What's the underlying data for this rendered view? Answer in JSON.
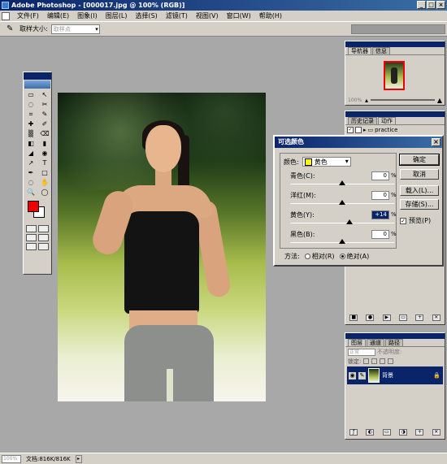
{
  "window": {
    "title": "Adobe Photoshop - [000017.jpg @ 100% (RGB)]",
    "buttons": [
      "_",
      "□",
      "×"
    ]
  },
  "menu": {
    "items": [
      "文件(F)",
      "编辑(E)",
      "图象(I)",
      "图层(L)",
      "选择(S)",
      "滤镜(T)",
      "视图(V)",
      "窗口(W)",
      "帮助(H)"
    ]
  },
  "options": {
    "sample_size_label": "取样大小:",
    "sample_size_value": "取样点"
  },
  "navigator": {
    "tabs": [
      "导航器",
      "信息"
    ],
    "zoom": "100%"
  },
  "history": {
    "tabs": [
      "历史记录",
      "动作"
    ],
    "rows": [
      {
        "check": "✓",
        "label": "practice"
      },
      {
        "check": "✓",
        "label": ""
      },
      {
        "check": "✓",
        "label": ""
      },
      {
        "check": "✓",
        "label": ""
      },
      {
        "check": "✓",
        "label": ""
      },
      {
        "check": "✓",
        "label": ""
      },
      {
        "check": "✓",
        "label": ""
      },
      {
        "check": "✓",
        "label": ""
      }
    ]
  },
  "layers": {
    "tabs": [
      "图层",
      "通道",
      "路径"
    ],
    "blend_mode": "正常",
    "opacity_label": "不透明度:",
    "lock_label": "锁定:",
    "layer_name": "背景"
  },
  "dialog": {
    "title": "可选颜色",
    "color_label": "颜色:",
    "color_value": "黄色",
    "color_swatch": "#ffff00",
    "sliders": [
      {
        "label": "青色(C):",
        "value": "0",
        "unit": "%",
        "position": 0.5,
        "selected": false
      },
      {
        "label": "洋红(M):",
        "value": "0",
        "unit": "%",
        "position": 0.5,
        "selected": false
      },
      {
        "label": "黄色(Y):",
        "value": "+14",
        "unit": "%",
        "position": 0.57,
        "selected": true
      },
      {
        "label": "黑色(B):",
        "value": "0",
        "unit": "%",
        "position": 0.5,
        "selected": false
      }
    ],
    "buttons": {
      "ok": "确定",
      "cancel": "取消",
      "load": "载入(L)...",
      "save": "存储(S)..."
    },
    "preview_label": "预览(P)",
    "method_label": "方法:",
    "method_relative": "相对(R)",
    "method_absolute": "绝对(A)"
  },
  "toolbox": {
    "tools": [
      "▭",
      "↖",
      "◌",
      "✂",
      "⌗",
      "✎",
      "✚",
      "✐",
      "▒",
      "⌫",
      "◧",
      "▮",
      "◢",
      "◉",
      "↗",
      "T",
      "✒",
      "□",
      "◌",
      "✋",
      "🔍",
      "◯"
    ]
  },
  "status": {
    "zoom": "100%",
    "doc_info": "文档:816K/816K"
  },
  "colors": {
    "accent": "#0a246a",
    "foreground": "#ee0000",
    "background": "#ffffff"
  }
}
